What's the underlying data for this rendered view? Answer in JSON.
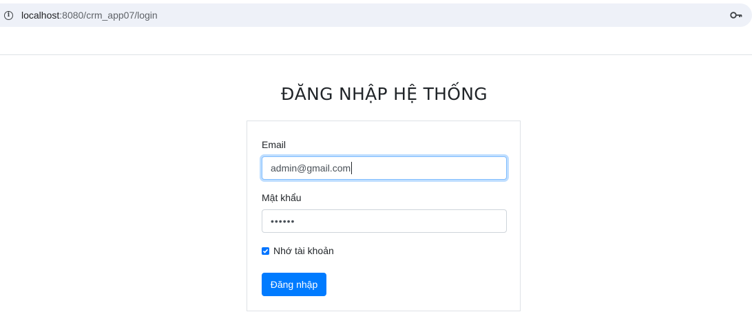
{
  "browser": {
    "url_host": "localhost",
    "url_path": ":8080/crm_app07/login"
  },
  "page": {
    "title": "ĐĂNG NHẬP HỆ THỐNG"
  },
  "form": {
    "email_label": "Email",
    "email_value": "admin@gmail.com",
    "password_label": "Mật khẩu",
    "password_value": "••••••",
    "remember_label": "Nhớ tài khoản",
    "remember_checked": true,
    "submit_label": "Đăng nhập"
  },
  "colors": {
    "primary": "#007bff",
    "focus_border": "#80bdff",
    "checkbox": "#0075ff"
  },
  "icons": {
    "site_info": "info-icon",
    "password_manager": "key-icon",
    "checkbox": "check-icon"
  }
}
